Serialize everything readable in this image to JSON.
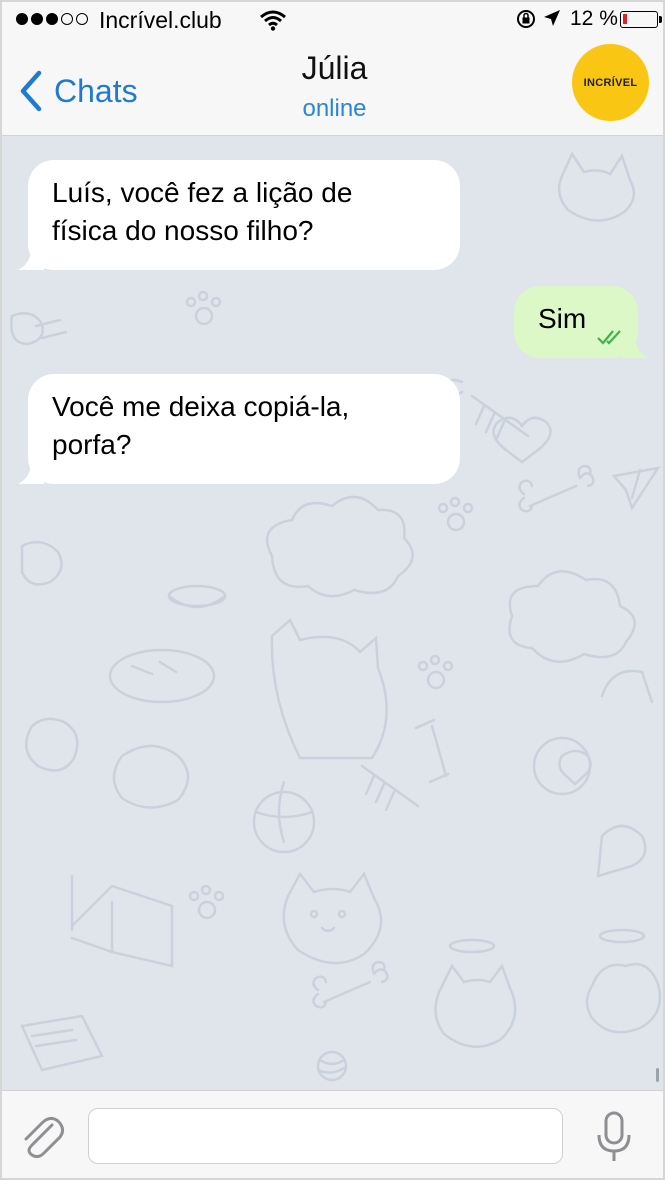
{
  "status_bar": {
    "signal_dots_filled": 3,
    "signal_dots_total": 5,
    "carrier": "Incrível.club",
    "battery_text": "12 %",
    "battery_level": 0.12,
    "battery_color": "#e12020",
    "icons": [
      "wifi-icon",
      "rotation-lock-icon",
      "location-arrow-icon",
      "battery-icon"
    ]
  },
  "header": {
    "back_label": "Chats",
    "contact_name": "Júlia",
    "contact_status": "online",
    "avatar_text": "INCRÍVEL",
    "avatar_color": "#f9c713"
  },
  "messages": [
    {
      "direction": "incoming",
      "lines": [
        "Luís, você fez a lição de",
        "física do nosso filho?"
      ]
    },
    {
      "direction": "outgoing",
      "lines": [
        "Sim"
      ],
      "read_receipt": "double-check"
    },
    {
      "direction": "incoming",
      "lines": [
        "Você me deixa copiá-la,",
        "porfa?"
      ]
    }
  ],
  "input_bar": {
    "placeholder": "",
    "value": "",
    "icons": [
      "paperclip-icon",
      "microphone-icon"
    ]
  },
  "colors": {
    "accent": "#1f7bd2",
    "chat_background": "#dfe5eb",
    "incoming_bubble": "#ffffff",
    "outgoing_bubble": "#dcf8c7",
    "read_check": "#3bb54a"
  }
}
